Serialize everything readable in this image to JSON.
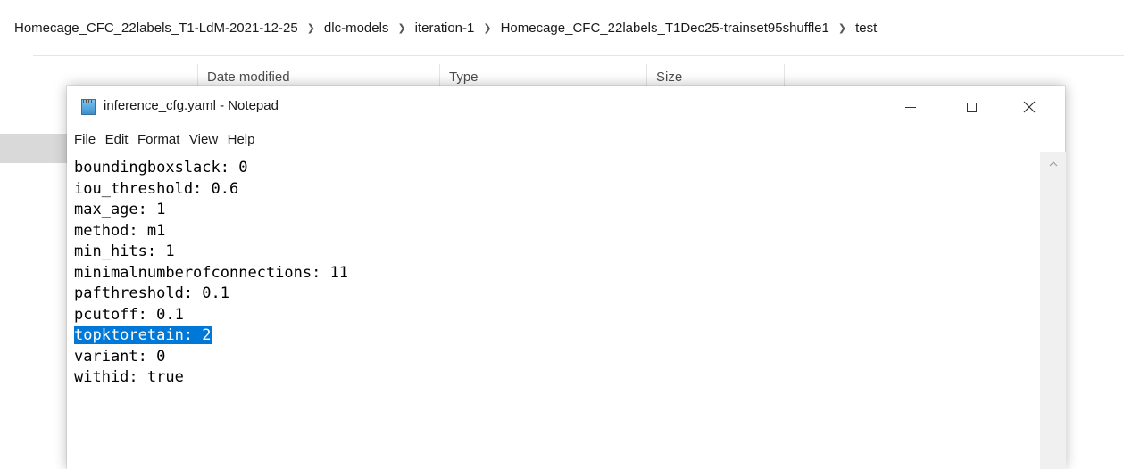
{
  "explorer": {
    "breadcrumb": [
      "Homecage_CFC_22labels_T1-LdM-2021-12-25",
      "dlc-models",
      "iteration-1",
      "Homecage_CFC_22labels_T1Dec25-trainset95shuffle1",
      "test"
    ],
    "columns": {
      "date_modified": "Date modified",
      "type": "Type",
      "size": "Size"
    }
  },
  "notepad": {
    "title": "inference_cfg.yaml - Notepad",
    "menu": [
      "File",
      "Edit",
      "Format",
      "View",
      "Help"
    ],
    "lines": [
      "boundingboxslack: 0",
      "iou_threshold: 0.6",
      "max_age: 1",
      "method: m1",
      "min_hits: 1",
      "minimalnumberofconnections: 11",
      "pafthreshold: 0.1",
      "pcutoff: 0.1",
      "topktoretain: 2",
      "variant: 0",
      "withid: true"
    ],
    "selected_line_index": 8,
    "icons": {
      "app": "notepad-icon",
      "minimize": "minimize-icon",
      "maximize": "maximize-icon",
      "close": "close-icon",
      "scroll_up": "chevron-up-icon"
    },
    "selection_color": "#0078d7"
  }
}
